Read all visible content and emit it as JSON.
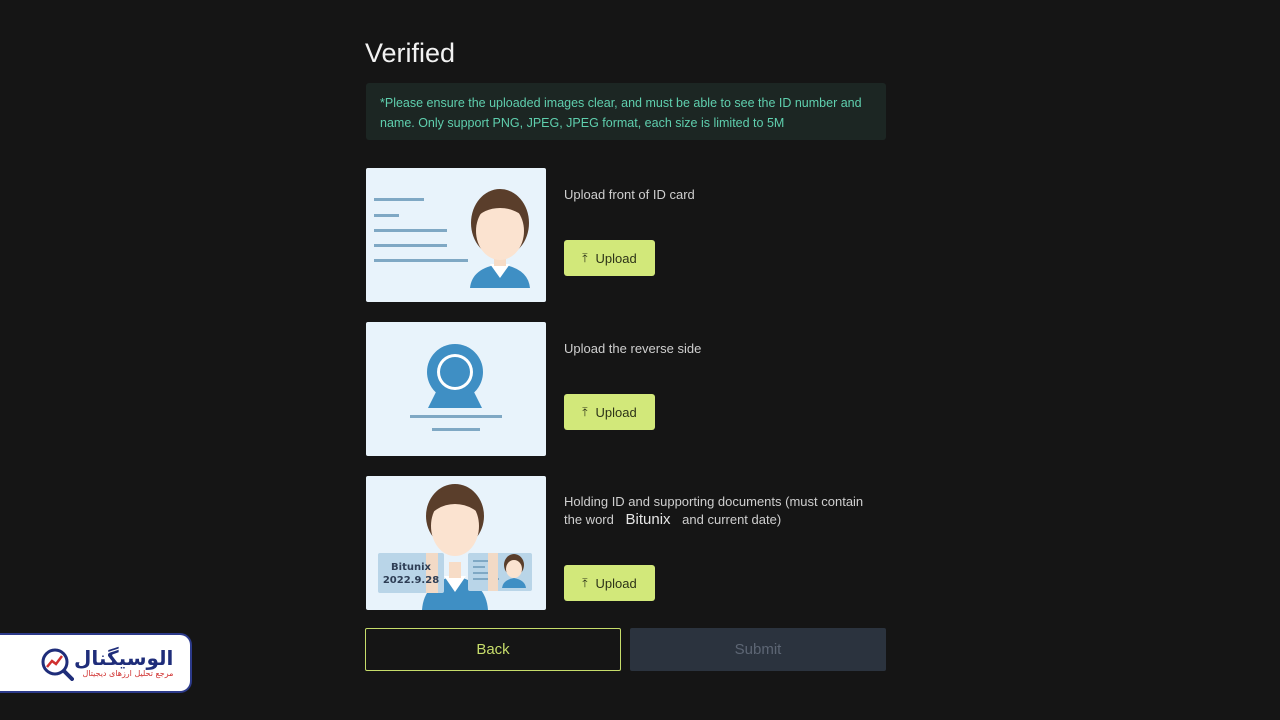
{
  "page": {
    "title": "Verified"
  },
  "notice": {
    "text": "*Please ensure the uploaded images clear, and must be able to see the ID number and name. Only support PNG, JPEG, JPEG format, each size is limited to 5M"
  },
  "uploads": [
    {
      "label": "Upload front of ID card",
      "button": "Upload",
      "icon": "upload-icon"
    },
    {
      "label": "Upload the reverse side",
      "button": "Upload",
      "icon": "upload-icon"
    },
    {
      "label_prefix": "Holding ID and supporting documents (must contain the word",
      "brand_word": "Bitunix",
      "label_suffix": "and current date)",
      "button": "Upload",
      "icon": "upload-icon"
    }
  ],
  "sample_card": {
    "brand": "Bitunix",
    "date": "2022.9.28"
  },
  "footer": {
    "back_label": "Back",
    "submit_label": "Submit"
  },
  "watermark": {
    "title": "الوسيگنال",
    "subtitle": "مرجع تحلیل ارزهای دیجیتال"
  },
  "colors": {
    "accent": "#d2e87a",
    "notice_text": "#5fcfae",
    "background": "#151515",
    "submit_disabled": "#2b333e"
  }
}
